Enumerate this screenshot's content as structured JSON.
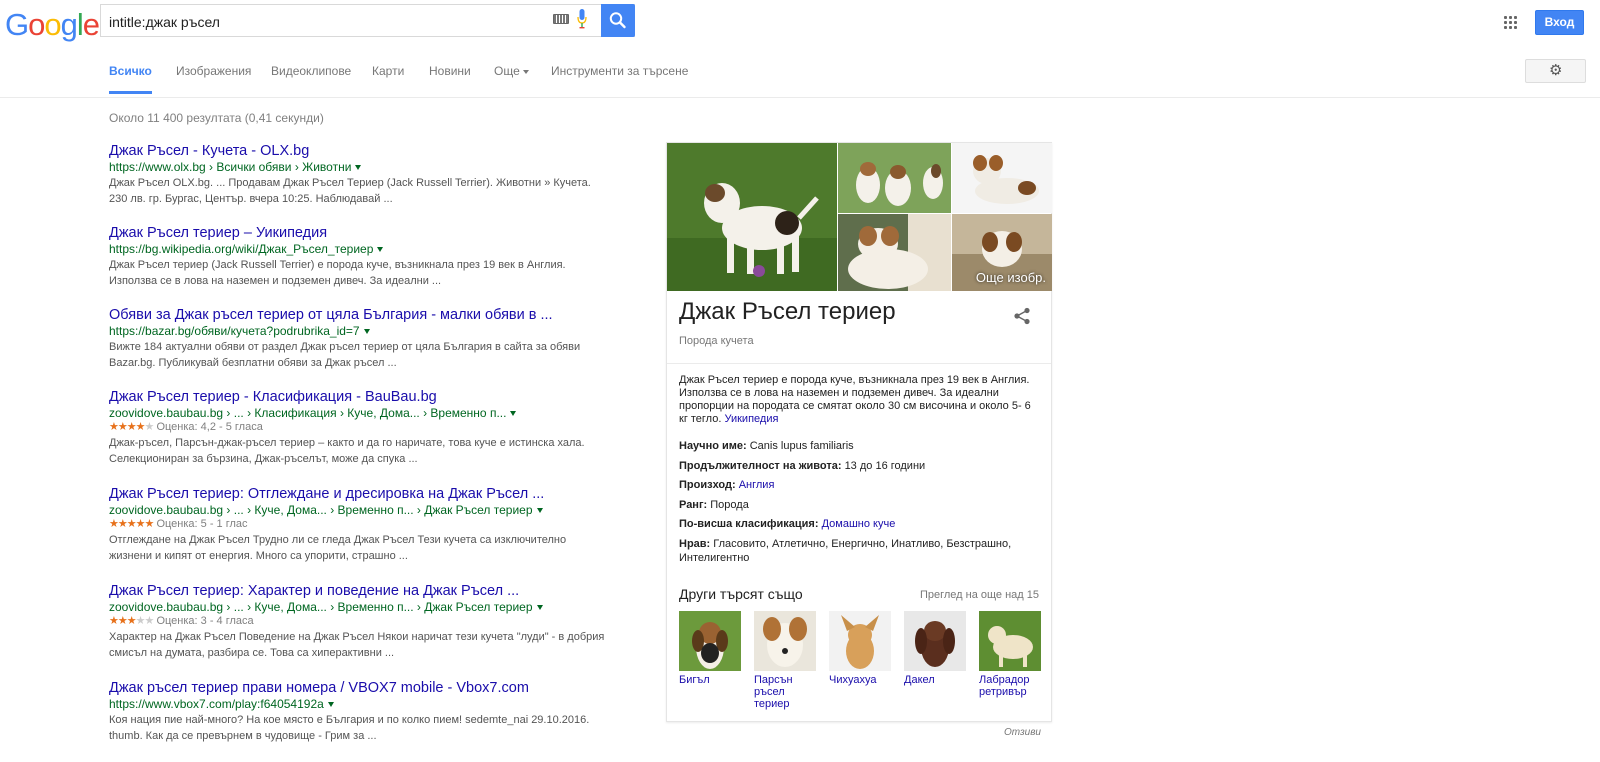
{
  "logo": {
    "letters": [
      "G",
      "o",
      "o",
      "g",
      "l",
      "e"
    ],
    "colors": [
      "#4285f4",
      "#ea4335",
      "#fbbc05",
      "#4285f4",
      "#34a853",
      "#ea4335"
    ]
  },
  "search": {
    "value": "intitle:джак ръсел",
    "keyboard_icon": "keyboard-icon",
    "mic_icon": "mic-icon",
    "button_icon": "search-icon"
  },
  "header": {
    "apps_icon": "apps-grid-icon",
    "signin_label": "Вход"
  },
  "tabs": [
    {
      "label": "Всичко",
      "active": true
    },
    {
      "label": "Изображения"
    },
    {
      "label": "Видеоклипове"
    },
    {
      "label": "Карти"
    },
    {
      "label": "Новини"
    },
    {
      "label": "Още"
    },
    {
      "label": "Инструменти за търсене"
    }
  ],
  "settings_icon": "gear-icon",
  "stats": "Около 11 400 резултата (0,41 секунди)",
  "results": [
    {
      "title": "Джак Ръсел - Кучета - OLX.bg",
      "url": "https://www.olx.bg › Всички обяви › Животни",
      "snippet_lines": [
        "Джак Ръсел OLX.bg. ... Продавам Джак Ръсел Териер (Jack Russell Terrier). Животни » Кучета.",
        "230 лв. гр. Бургас, Център. вчера 10:25. Наблюдавай ..."
      ]
    },
    {
      "title": "Джак Ръсел териер – Уикипедия",
      "url": "https://bg.wikipedia.org/wiki/Джак_Ръсел_териер",
      "snippet_lines": [
        "Джак Ръсел териер (Jack Russell Terrier) е порода куче, възникнала през 19 век в Англия.",
        "Използва се в лова на наземен и подземен дивеч. За идеални ..."
      ]
    },
    {
      "title": "Обяви за Джак ръсел териер от цяла България - малки обяви в ...",
      "url": "https://bazar.bg/обяви/кучета?podrubrika_id=7",
      "snippet_lines": [
        "Вижте 184 актуални обяви от раздел Джак ръсел териер от цяла България в сайта за обяви",
        "Bazar.bg. Публикувай безплатни обяви за Джак ръсел ..."
      ]
    },
    {
      "title": "Джак Ръсел териер - Класификация - BauBau.bg",
      "url": "zoovidove.baubau.bg › ... › Класификация › Куче, Дома... › Временно п...",
      "rating_text": "Оценка: 4,2 - 5 гласа",
      "stars_filled": 4,
      "snippet_lines": [
        "Джак-ръсел, Парсън-джак-ръсел териер – както и да го наричате, това куче е истинска хала.",
        "Селекциониран за бързина, Джак-ръселът, може да спука ..."
      ]
    },
    {
      "title": "Джак Ръсел териер: Отглеждане и дресировка на Джак Ръсел ...",
      "url": "zoovidove.baubau.bg › ... › Куче, Дома... › Временно п... › Джак Ръсел териер",
      "rating_text": "Оценка: 5 - 1 глас",
      "stars_filled": 5,
      "snippet_lines": [
        "Отглеждане на Джак Ръсел Трудно ли се гледа Джак Ръсел Тези кучета са изключително",
        "жизнени и кипят от енергия. Много са упорити, страшно ..."
      ]
    },
    {
      "title": "Джак Ръсел териер: Характер и поведение на Джак Ръсел ...",
      "url": "zoovidove.baubau.bg › ... › Куче, Дома... › Временно п... › Джак Ръсел териер",
      "rating_text": "Оценка: 3 - 4 гласа",
      "stars_filled": 3,
      "snippet_lines": [
        "Характер на Джак Ръсел Поведение на Джак Ръсел Някои наричат тези кучета \"луди\" - в добрия",
        "смисъл на думата, разбира се. Това са хиперактивни ..."
      ]
    },
    {
      "title": "Джак ръсел териер прави номера / VBOX7 mobile - Vbox7.com",
      "url": "https://www.vbox7.com/play:f64054192a",
      "snippet_lines": [
        "Коя нация пие най-много? На кое място е България и по колко пием! sedemte_nai 29.10.2016.",
        "thumb. Как да се превърнем в чудовище - Грим за ..."
      ]
    }
  ],
  "kp": {
    "more_images": "Още изобр.",
    "title": "Джак Ръсел териер",
    "subtitle": "Порода кучета",
    "share_icon": "share-icon",
    "description": "Джак Ръсел териер е порода куче, възникнала през 19 век в Англия. Използва се в лова на наземен и подземен дивеч. За идеални пропорции на породата се смятат около 30 см височина и около 5- 6 кг тегло.",
    "desc_link": "Уикипедия",
    "facts": [
      {
        "label": "Научно име:",
        "value": "Canis lupus familiaris",
        "link": false
      },
      {
        "label": "Продължителност на живота:",
        "value": "13 до 16 години",
        "link": false
      },
      {
        "label": "Произход:",
        "value": "Англия",
        "link": true
      },
      {
        "label": "Ранг:",
        "value": "Порода",
        "link": false
      },
      {
        "label": "По-висша класификация:",
        "value": "Домашно куче",
        "link": true
      },
      {
        "label": "Нрав:",
        "value": "Гласовито, Атлетично, Енергично, Инатливо, Безстрашно, Интелигентно",
        "link": false
      }
    ],
    "also_title": "Други търсят също",
    "also_more": "Преглед на още над 15",
    "also": [
      {
        "label": "Бигъл"
      },
      {
        "label": "Парсън ръсел териер"
      },
      {
        "label": "Чихуахуа"
      },
      {
        "label": "Дакел"
      },
      {
        "label": "Лабрадор ретривър"
      }
    ]
  },
  "feedback": "Отзиви"
}
